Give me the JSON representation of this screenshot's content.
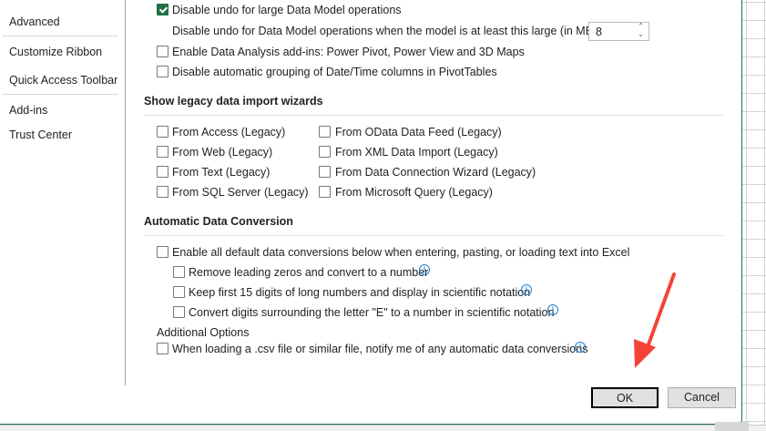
{
  "nav": {
    "items": [
      "Advanced",
      "Customize Ribbon",
      "Quick Access Toolbar",
      "Add-ins",
      "Trust Center"
    ]
  },
  "data_model": {
    "disable_undo_large": {
      "label": "Disable undo for large Data Model operations",
      "checked": true
    },
    "threshold_label": "Disable undo for Data Model operations when the model is at least this large (in MB):",
    "threshold_value": "8",
    "enable_addins": {
      "label": "Enable Data Analysis add-ins: Power Pivot, Power View and 3D Maps",
      "checked": false
    },
    "disable_grouping": {
      "label": "Disable automatic grouping of Date/Time columns in PivotTables",
      "checked": false
    }
  },
  "legacy": {
    "heading": "Show legacy data import wizards",
    "left": [
      "From Access (Legacy)",
      "From Web (Legacy)",
      "From Text (Legacy)",
      "From SQL Server (Legacy)"
    ],
    "right": [
      "From OData Data Feed (Legacy)",
      "From XML Data Import (Legacy)",
      "From Data Connection Wizard (Legacy)",
      "From Microsoft Query (Legacy)"
    ]
  },
  "conversion": {
    "heading": "Automatic Data Conversion",
    "enable_all": "Enable all default data conversions below when entering, pasting, or loading text into Excel",
    "remove_zeros": "Remove leading zeros and convert to a number",
    "keep_15": "Keep first 15 digits of long numbers and display in scientific notation",
    "convert_e": "Convert digits surrounding the letter \"E\" to a number in scientific notation",
    "additional_heading": "Additional Options",
    "notify_csv": "When loading a .csv file or similar file, notify me of any automatic data conversions",
    "info_glyph": "i"
  },
  "buttons": {
    "ok": "OK",
    "cancel": "Cancel"
  },
  "colors": {
    "accent": "#1e7145",
    "arrow": "#f44336",
    "info": "#1a7fd1"
  }
}
